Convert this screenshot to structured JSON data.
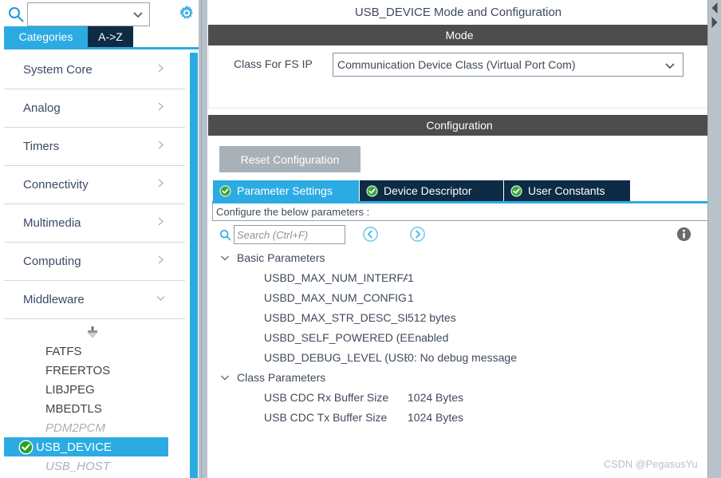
{
  "sidebar": {
    "search": {
      "value": "",
      "placeholder": ""
    },
    "search_icon": "search-icon",
    "gear_icon": "gear-icon",
    "tabs": [
      {
        "label": "Categories",
        "active": true
      },
      {
        "label": "A->Z",
        "active": false
      }
    ],
    "categories": [
      {
        "label": "System Core",
        "expanded": false
      },
      {
        "label": "Analog",
        "expanded": false
      },
      {
        "label": "Timers",
        "expanded": false
      },
      {
        "label": "Connectivity",
        "expanded": false
      },
      {
        "label": "Multimedia",
        "expanded": false
      },
      {
        "label": "Computing",
        "expanded": false
      },
      {
        "label": "Middleware",
        "expanded": true
      }
    ],
    "middleware_children": [
      {
        "label": "FATFS",
        "state": "normal"
      },
      {
        "label": "FREERTOS",
        "state": "normal"
      },
      {
        "label": "LIBJPEG",
        "state": "normal"
      },
      {
        "label": "MBEDTLS",
        "state": "normal"
      },
      {
        "label": "PDM2PCM",
        "state": "disabled"
      },
      {
        "label": "USB_DEVICE",
        "state": "selected"
      },
      {
        "label": "USB_HOST",
        "state": "disabled"
      }
    ]
  },
  "main": {
    "title": "USB_DEVICE Mode and Configuration",
    "mode": {
      "header": "Mode",
      "class_label": "Class For FS IP",
      "class_value": "Communication Device Class (Virtual Port Com)"
    },
    "configuration": {
      "header": "Configuration",
      "reset_label": "Reset Configuration",
      "tabs": [
        {
          "label": "Parameter Settings",
          "active": true,
          "icon": "green-check-icon"
        },
        {
          "label": "Device Descriptor",
          "active": false,
          "icon": "green-check-icon"
        },
        {
          "label": "User Constants",
          "active": false,
          "icon": "green-check-icon"
        }
      ],
      "note": "Configure the below parameters :",
      "search": {
        "value": "",
        "placeholder": "Search (Ctrl+F)"
      },
      "nav_back_icon": "circle-left-arrow-icon",
      "nav_forward_icon": "circle-right-arrow-icon",
      "info_icon": "info-icon",
      "groups": [
        {
          "label": "Basic Parameters",
          "expanded": true,
          "rows": [
            {
              "name": "USBD_MAX_NUM_INTERFACE...",
              "value": "1"
            },
            {
              "name": "USBD_MAX_NUM_CONFIGUR...",
              "value": "1"
            },
            {
              "name": "USBD_MAX_STR_DESC_SIZ (...",
              "value": "512 bytes"
            },
            {
              "name": "USBD_SELF_POWERED (Enab...",
              "value": "Enabled"
            },
            {
              "name": "USBD_DEBUG_LEVEL (USBD ...",
              "value": "0: No debug message"
            }
          ]
        },
        {
          "label": "Class Parameters",
          "expanded": true,
          "rows": [
            {
              "name": "USB CDC Rx Buffer Size",
              "value": "1024 Bytes"
            },
            {
              "name": "USB CDC Tx Buffer Size",
              "value": "1024 Bytes"
            }
          ]
        }
      ]
    }
  },
  "watermark": "CSDN @PegasusYu",
  "colors": {
    "accent_blue": "#2cabe3",
    "tab_dark": "#0d2b45",
    "header_gray": "#4d4d4d",
    "button_gray": "#a9b1b8",
    "check_green": "#3aa13a",
    "divider_gray": "#b7c2cb"
  }
}
